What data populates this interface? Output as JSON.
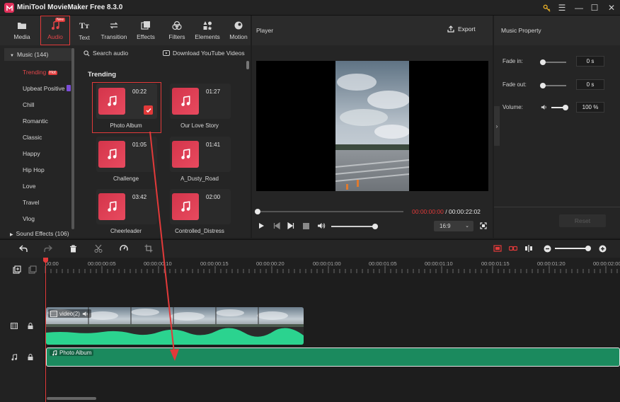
{
  "window": {
    "title": "MiniTool MovieMaker Free 8.3.0"
  },
  "toolbar": {
    "tabs": [
      {
        "label": "Media"
      },
      {
        "label": "Audio",
        "badge": "New"
      },
      {
        "label": "Text"
      },
      {
        "label": "Transition"
      },
      {
        "label": "Effects"
      },
      {
        "label": "Filters"
      },
      {
        "label": "Elements"
      },
      {
        "label": "Motion"
      }
    ]
  },
  "library": {
    "music_category": "Music (144)",
    "items": [
      "Trending",
      "Upbeat Positive",
      "Chill",
      "Romantic",
      "Classic",
      "Happy",
      "Hip Hop",
      "Love",
      "Travel",
      "Vlog"
    ],
    "hot_badge": "Hot",
    "sound_effects": "Sound Effects (106)",
    "search_label": "Search audio",
    "download_label": "Download YouTube Videos",
    "section_title": "Trending",
    "tracks": [
      {
        "name": "Photo Album",
        "duration": "00:22"
      },
      {
        "name": "Our Love Story",
        "duration": "01:27"
      },
      {
        "name": "Challenge",
        "duration": "01:05"
      },
      {
        "name": "A_Dusty_Road",
        "duration": "01:41"
      },
      {
        "name": "Cheerleader",
        "duration": "03:42"
      },
      {
        "name": "Controlled_Distress",
        "duration": "02:00"
      }
    ]
  },
  "player": {
    "title": "Player",
    "export_label": "Export",
    "current_time": "00:00:00:00",
    "total_time": " / 00:00:22:02",
    "progress": 0,
    "volume": 1.0,
    "aspect_ratio": "16:9"
  },
  "music_property": {
    "title": "Music Property",
    "fade_in_label": "Fade in:",
    "fade_in_value": "0 s",
    "fade_out_label": "Fade out:",
    "fade_out_value": "0 s",
    "volume_label": "Volume:",
    "volume_value": "100 %",
    "reset_label": "Reset"
  },
  "timeline": {
    "ticks": [
      "00:00",
      "00:00:00:05",
      "00:00:00:10",
      "00:00:00:15",
      "00:00:00:20",
      "00:00:01:00",
      "00:00:01:05",
      "00:00:01:10",
      "00:00:01:15",
      "00:00:01:20",
      "00:00:02:00"
    ],
    "video_clip_label": "video(2)",
    "audio_clip_label": "Photo Album"
  },
  "colors": {
    "accent": "#e23a3a",
    "audio_track": "#1b8a5e",
    "waveform": "#2bd38f"
  }
}
